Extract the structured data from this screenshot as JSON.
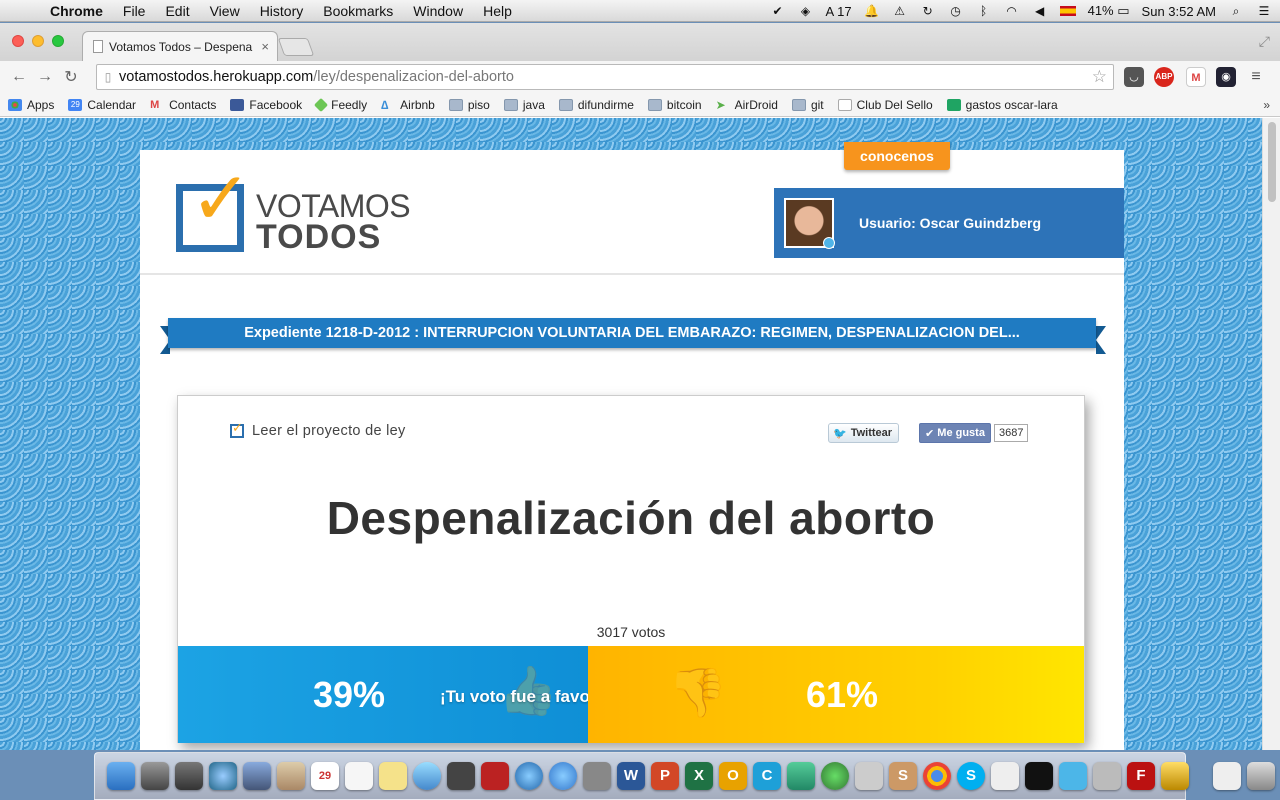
{
  "menubar": {
    "app": "Chrome",
    "items": [
      "File",
      "Edit",
      "View",
      "History",
      "Bookmarks",
      "Window",
      "Help"
    ],
    "notification_count": "17",
    "battery": "41%",
    "clock": "Sun 3:52 AM"
  },
  "browser": {
    "tab_title": "Votamos Todos – Despena",
    "url_host": "votamostodos.herokuapp.com",
    "url_path": "/ley/despenalizacion-del-aborto",
    "bookmarks": [
      "Apps",
      "Calendar",
      "Contacts",
      "Facebook",
      "Feedly",
      "Airbnb",
      "piso",
      "java",
      "difundirme",
      "bitcoin",
      "AirDroid",
      "git",
      "Club Del Sello",
      "gastos oscar-lara"
    ],
    "calendar_day": "29",
    "ext_abp": "ABP"
  },
  "site": {
    "logo_line1": "VOTAMOS",
    "logo_line2": "TODOS",
    "conocenos": "conocenos",
    "user_label": "Usuario: Oscar Guindzberg",
    "expediente": "Expediente 1218-D-2012 : INTERRUPCION VOLUNTARIA DEL EMBARAZO: REGIMEN, DESPENALIZACION DEL...",
    "read_project": "Leer el proyecto de ley",
    "tweet_label": "Twittear",
    "like_label": "Me gusta",
    "like_count": "3687",
    "law_title": "Despenalización del aborto",
    "votes_total": "3017 votos",
    "favor_pct": "39%",
    "contra_pct": "61%",
    "favor_fraction": 0.39,
    "your_vote": "¡Tu voto fue a favor!"
  },
  "dock": {
    "calendar_day": "29"
  }
}
